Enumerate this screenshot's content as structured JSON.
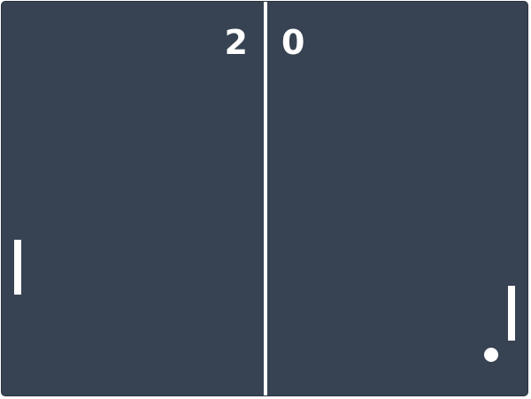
{
  "game": {
    "name": "Pong",
    "scores": {
      "left": "2",
      "right": "0"
    },
    "colors": {
      "background": "#374352",
      "foreground": "#ffffff"
    }
  }
}
